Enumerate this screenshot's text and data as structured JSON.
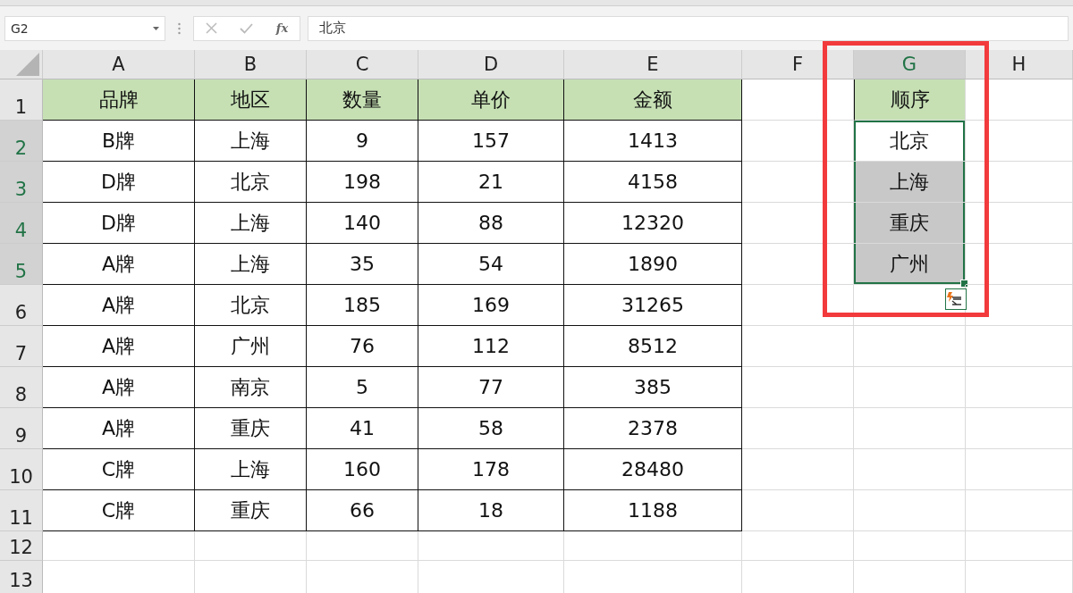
{
  "name_box": {
    "value": "G2"
  },
  "formula_bar": {
    "function_label": "fx",
    "value": "北京"
  },
  "columns": [
    {
      "label": "A",
      "selected": false
    },
    {
      "label": "B",
      "selected": false
    },
    {
      "label": "C",
      "selected": false
    },
    {
      "label": "D",
      "selected": false
    },
    {
      "label": "E",
      "selected": false
    },
    {
      "label": "F",
      "selected": false
    },
    {
      "label": "G",
      "selected": true
    },
    {
      "label": "H",
      "selected": false
    }
  ],
  "rows": [
    {
      "label": "1",
      "selected": false
    },
    {
      "label": "2",
      "selected": true
    },
    {
      "label": "3",
      "selected": true
    },
    {
      "label": "4",
      "selected": true
    },
    {
      "label": "5",
      "selected": true
    },
    {
      "label": "6",
      "selected": false
    },
    {
      "label": "7",
      "selected": false
    },
    {
      "label": "8",
      "selected": false
    },
    {
      "label": "9",
      "selected": false
    },
    {
      "label": "10",
      "selected": false
    },
    {
      "label": "11",
      "selected": false
    },
    {
      "label": "12",
      "selected": false
    },
    {
      "label": "13",
      "selected": false
    }
  ],
  "table": {
    "header": [
      "品牌",
      "地区",
      "数量",
      "单价",
      "金额"
    ],
    "rows": [
      [
        "B牌",
        "上海",
        "9",
        "157",
        "1413"
      ],
      [
        "D牌",
        "北京",
        "198",
        "21",
        "4158"
      ],
      [
        "D牌",
        "上海",
        "140",
        "88",
        "12320"
      ],
      [
        "A牌",
        "上海",
        "35",
        "54",
        "1890"
      ],
      [
        "A牌",
        "北京",
        "185",
        "169",
        "31265"
      ],
      [
        "A牌",
        "广州",
        "76",
        "112",
        "8512"
      ],
      [
        "A牌",
        "南京",
        "5",
        "77",
        "385"
      ],
      [
        "A牌",
        "重庆",
        "41",
        "58",
        "2378"
      ],
      [
        "C牌",
        "上海",
        "160",
        "178",
        "28480"
      ],
      [
        "C牌",
        "重庆",
        "66",
        "18",
        "1188"
      ]
    ]
  },
  "order_column": {
    "header": "顺序",
    "cells": [
      {
        "text": "北京",
        "selected": true,
        "active": true
      },
      {
        "text": "上海",
        "selected": true,
        "active": false
      },
      {
        "text": "重庆",
        "selected": true,
        "active": false
      },
      {
        "text": "广州",
        "selected": true,
        "active": false
      }
    ]
  }
}
